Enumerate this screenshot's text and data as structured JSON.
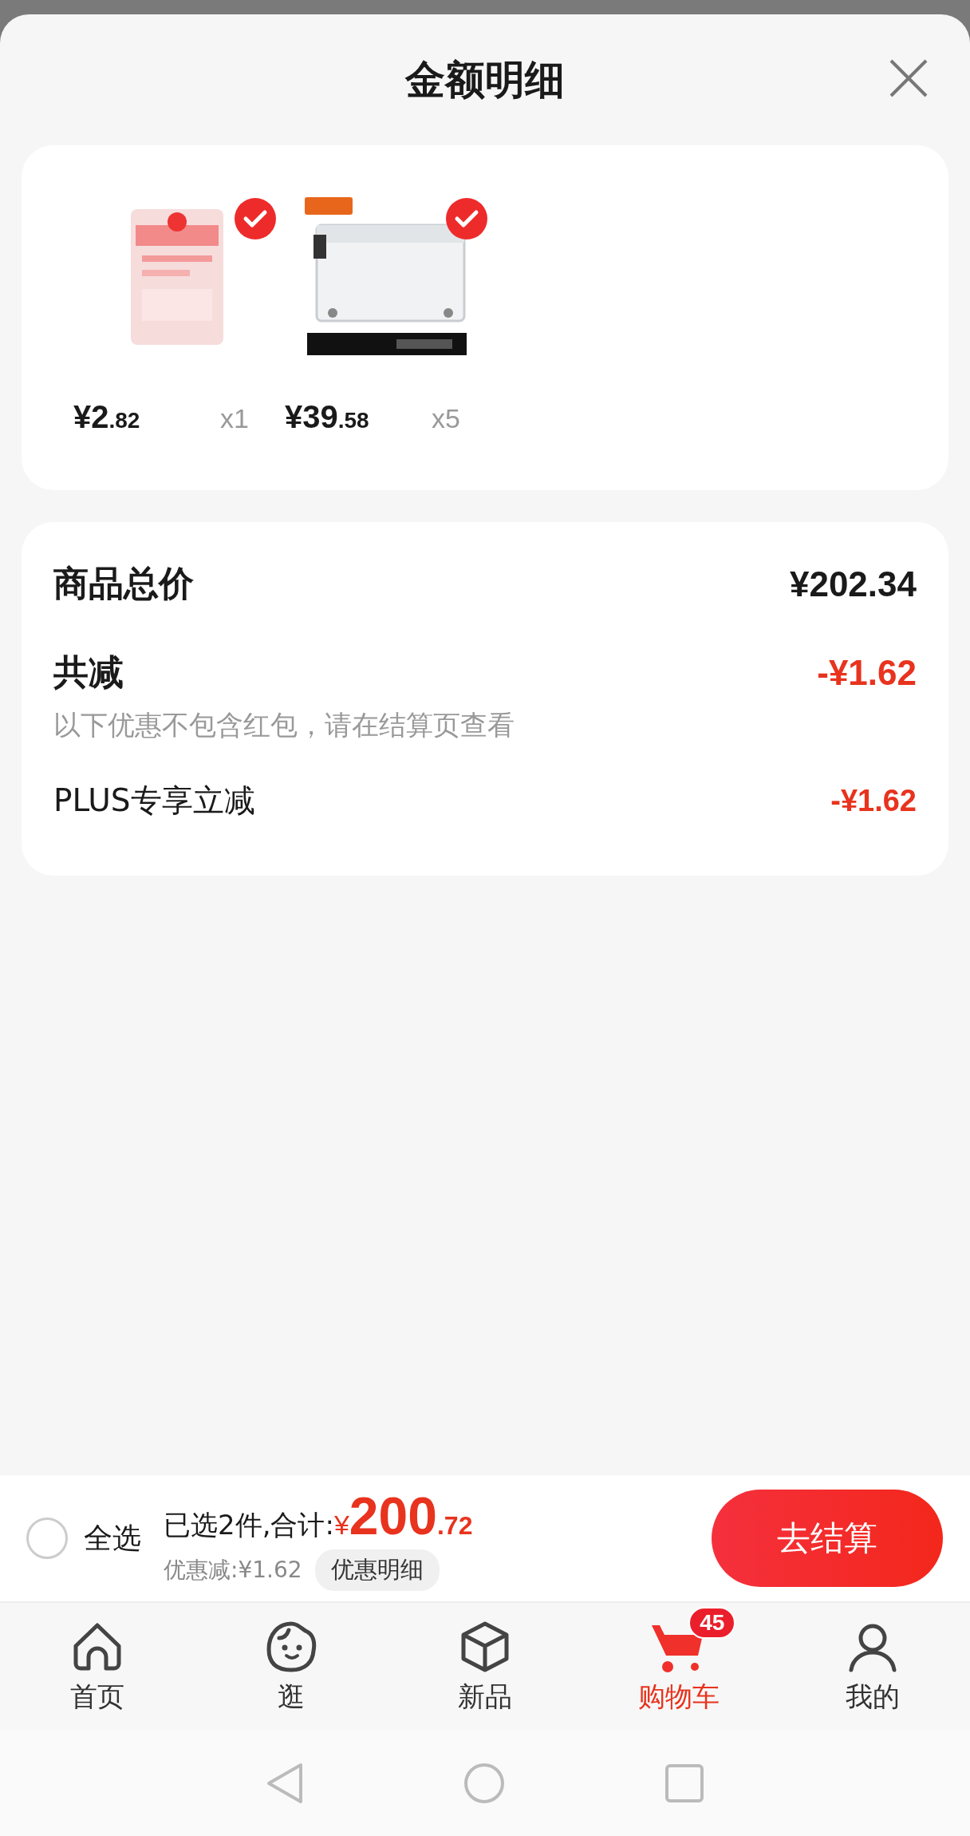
{
  "header": {
    "title": "金额明细"
  },
  "products": [
    {
      "kind": "picture",
      "selected": true,
      "price_main": "¥2",
      "price_cents": ".82",
      "quantity": "x1"
    },
    {
      "kind": "picture",
      "selected": true,
      "price_main": "¥39",
      "price_cents": ".58",
      "quantity": "x5"
    }
  ],
  "summary": {
    "total": {
      "label": "商品总价",
      "amount": "¥202.34"
    },
    "discount": {
      "label": "共减",
      "amount": "-¥1.62",
      "note": "以下优惠不包含红包，请在结算页查看"
    },
    "items": [
      {
        "label": "PLUS专享立减",
        "amount": "-¥1.62"
      }
    ]
  },
  "checkout": {
    "select_all": {
      "label": "全选",
      "checked": false
    },
    "summary_label": "已选2件,合计:",
    "currency": "¥",
    "total_main": "200",
    "total_cents": ".72",
    "discount_text": "优惠减:¥1.62",
    "details_button": "优惠明细",
    "checkout_button": "去结算"
  },
  "tabs": [
    {
      "kind": "home",
      "label": "首页",
      "selected": false
    },
    {
      "kind": "browse",
      "label": "逛",
      "selected": false
    },
    {
      "kind": "new",
      "label": "新品",
      "selected": false
    },
    {
      "kind": "cart",
      "label": "购物车",
      "selected": true,
      "badge": "45"
    },
    {
      "kind": "profile",
      "label": "我的",
      "selected": false
    }
  ]
}
